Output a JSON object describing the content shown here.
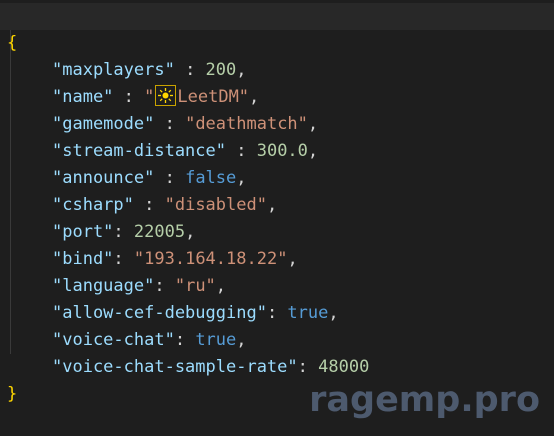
{
  "editor": {
    "open_brace": "{",
    "close_brace": "}",
    "entries": [
      {
        "key": "\"maxplayers\"",
        "sep": " : ",
        "value": "200",
        "value_type": "num",
        "trail": ","
      },
      {
        "key": "\"name\"",
        "sep": " : ",
        "value_prefix": "\"",
        "value_icon": "sun-icon",
        "value": "LeetDM\"",
        "value_type": "str",
        "trail": ","
      },
      {
        "key": "\"gamemode\"",
        "sep": " : ",
        "value": "\"deathmatch\"",
        "value_type": "str",
        "trail": ","
      },
      {
        "key": "\"stream-distance\"",
        "sep": " : ",
        "value": "300.0",
        "value_type": "num",
        "trail": ","
      },
      {
        "key": "\"announce\"",
        "sep": " : ",
        "value": "false",
        "value_type": "bool",
        "trail": ","
      },
      {
        "key": "\"csharp\"",
        "sep": " : ",
        "value": "\"disabled\"",
        "value_type": "str",
        "trail": ","
      },
      {
        "key": "\"port\"",
        "sep": ": ",
        "value": "22005",
        "value_type": "num",
        "trail": ","
      },
      {
        "key": "\"bind\"",
        "sep": ": ",
        "value": "\"193.164.18.22\"",
        "value_type": "str",
        "trail": ","
      },
      {
        "key": "\"language\"",
        "sep": ": ",
        "value": "\"ru\"",
        "value_type": "str",
        "trail": ","
      },
      {
        "key": "\"allow-cef-debugging\"",
        "sep": ": ",
        "value": "true",
        "value_type": "bool",
        "trail": ","
      },
      {
        "key": "\"voice-chat\"",
        "sep": ": ",
        "value": "true",
        "value_type": "bool",
        "trail": ","
      },
      {
        "key": "\"voice-chat-sample-rate\"",
        "sep": ": ",
        "value": "48000",
        "value_type": "num",
        "trail": ""
      }
    ]
  },
  "watermark": "ragemp.pro",
  "colors": {
    "background": "#1e1e1e",
    "current_line": "#282828",
    "key": "#9cdcfe",
    "string": "#ce9178",
    "number": "#b5cea8",
    "boolean": "#569cd6",
    "brace": "#ffd700",
    "watermark": "#4d5a6e"
  }
}
